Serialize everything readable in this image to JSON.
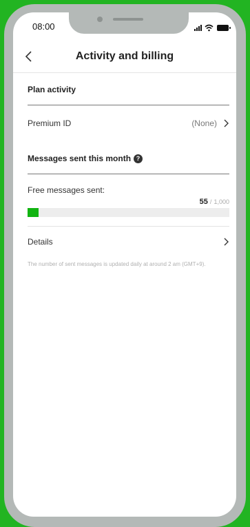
{
  "status_bar": {
    "time": "08:00",
    "icons": [
      "signal-icon",
      "wifi-icon",
      "battery-icon"
    ]
  },
  "header": {
    "back_icon": "chevron-left-icon",
    "title": "Activity and billing"
  },
  "plan_activity": {
    "title": "Plan activity",
    "premium_id": {
      "label": "Premium ID",
      "value": "(None)",
      "icon": "chevron-right-icon"
    }
  },
  "messages": {
    "title": "Messages sent this month",
    "help_icon": "help-icon",
    "help_glyph": "?",
    "free_label": "Free messages sent:",
    "sent_count": "55",
    "separator": "/",
    "limit": "1,000",
    "progress_fraction": 0.055,
    "progress_color": "#12b412"
  },
  "details": {
    "label": "Details",
    "icon": "chevron-right-icon"
  },
  "note": "The number of sent messages is updated daily at around 2 am (GMT+9).",
  "colors": {
    "background": "#22b422",
    "device_frame": "#b4b9b7",
    "accent": "#12b412"
  }
}
